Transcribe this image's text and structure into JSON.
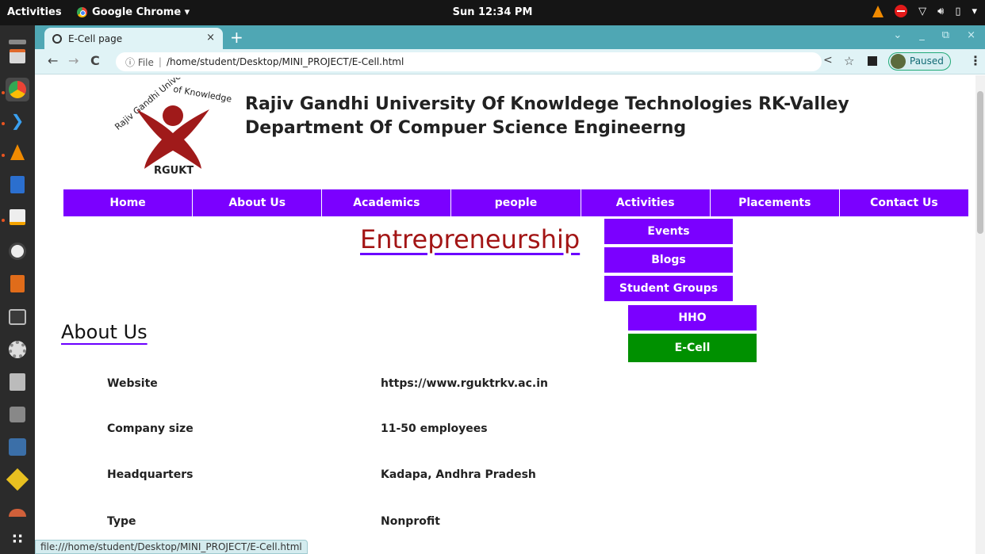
{
  "system": {
    "activities_label": "Activities",
    "app_name": "Google Chrome ▾",
    "clock": "Sun 12:34 PM",
    "tray": [
      "▾",
      "♣",
      "◀)"
    ]
  },
  "browser": {
    "tab_title": "E-Cell page",
    "tab_close": "×",
    "new_tab": "+",
    "window_controls": [
      "⌄",
      "_",
      "⧉",
      "×"
    ],
    "address_info": "ⓘ File",
    "address_divider": "|",
    "address_url": "/home/student/Desktop/MINI_PROJECT/E-Cell.html",
    "profile_status": "Paused",
    "status_url": "file:///home/student/Desktop/MINI_PROJECT/E-Cell.html"
  },
  "site": {
    "logo_text": "RGUKT",
    "logo_ring_text": "Rajiv Gandhi University of Knowledge Technologies",
    "title_line1": "Rajiv Gandhi University Of Knowldege Technologies RK-Valley",
    "title_line2": "Department Of Compuer Science Engineerng",
    "nav": [
      "Home",
      "About Us",
      "Academics",
      "people",
      "Activities",
      "Placements",
      "Contact Us"
    ],
    "activities_menu": [
      "Events",
      "Blogs",
      "Student Groups"
    ],
    "student_groups_menu": [
      "HHO",
      "E-Cell"
    ],
    "page_heading": "Entrepreneurship",
    "about_heading": "About Us",
    "info": [
      {
        "key": "Website",
        "value": "https://www.rguktrkv.ac.in"
      },
      {
        "key": "Company size",
        "value": "11-50 employees"
      },
      {
        "key": "Headquarters",
        "value": "Kadapa, Andhra Pradesh"
      },
      {
        "key": "Type",
        "value": "Nonprofit"
      }
    ]
  },
  "colors": {
    "nav_purple": "#7b00ff",
    "active_green": "#009000",
    "heading_red": "#a31515",
    "tab_strip": "#4fa7b4"
  }
}
